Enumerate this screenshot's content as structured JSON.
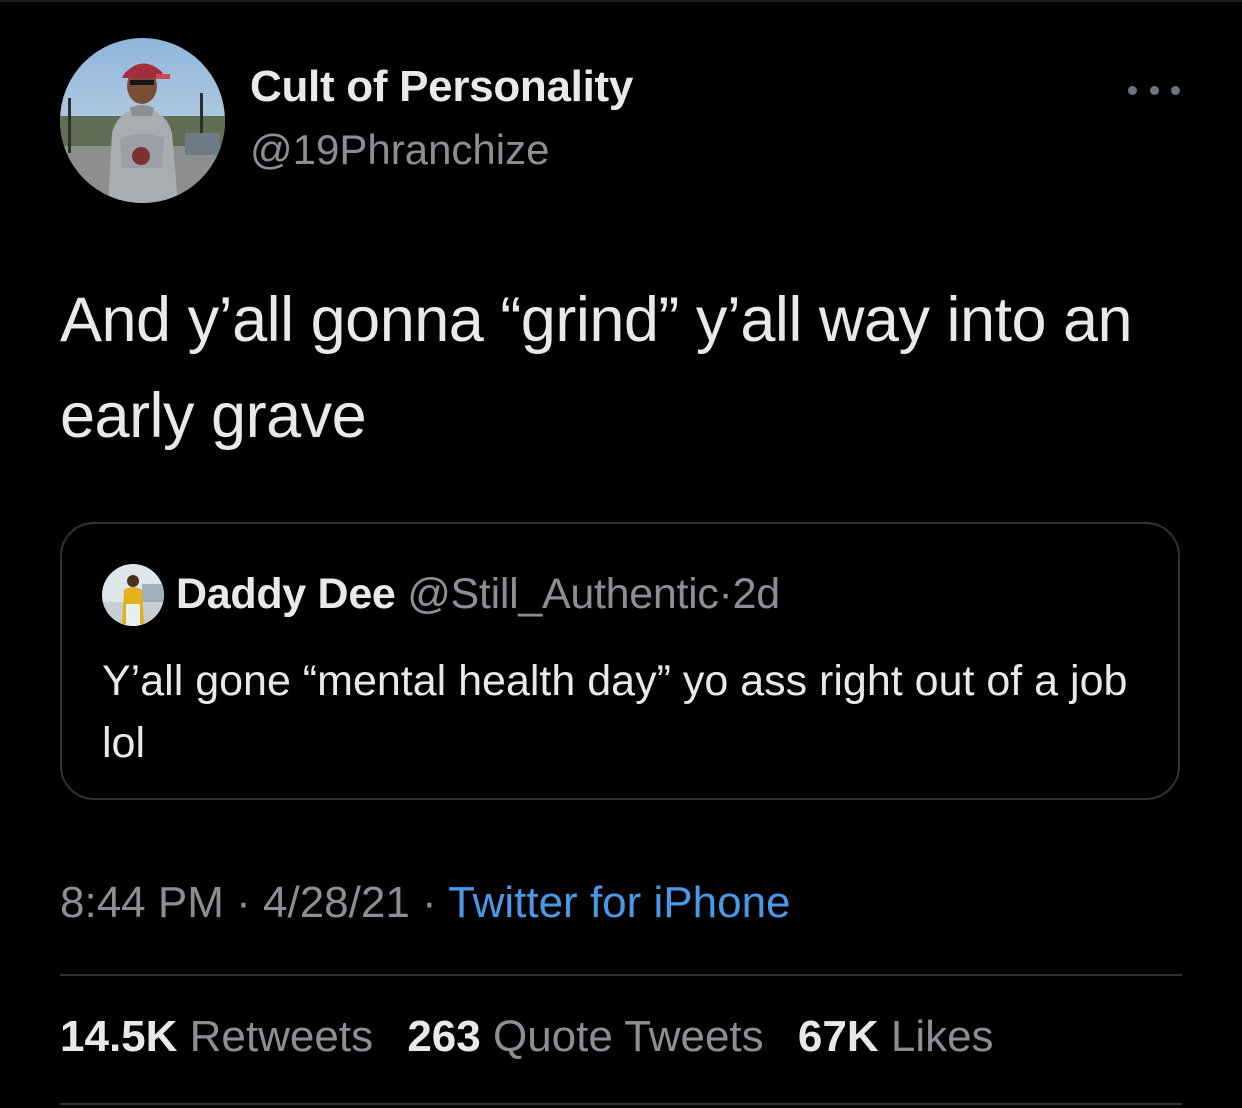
{
  "tweet": {
    "author": {
      "name": "Cult of Personality",
      "handle": "@19Phranchize",
      "avatar_icon": "profile-photo-man-red-cap-gray-hoodie"
    },
    "text": "And y’all gonna “grind” y’all way into an early grave",
    "quoted": {
      "name": "Daddy Dee",
      "handle": "@Still_Authentic",
      "separator": "·",
      "age": "2d",
      "text": "Y’all gone “mental health day” yo ass right out of a job lol",
      "avatar_icon": "profile-photo-person-yellow-jacket"
    },
    "time": "8:44 PM",
    "separator": "·",
    "date": "4/28/21",
    "source": "Twitter for iPhone",
    "stats": {
      "retweets_count": "14.5K",
      "retweets_label": "Retweets",
      "quotes_count": "263",
      "quotes_label": "Quote Tweets",
      "likes_count": "67K",
      "likes_label": "Likes"
    }
  },
  "colors": {
    "background": "#000000",
    "primary_text": "#e7e9ea",
    "secondary_text": "#8b8f94",
    "link": "#4a99e9",
    "border": "#2f3336"
  }
}
